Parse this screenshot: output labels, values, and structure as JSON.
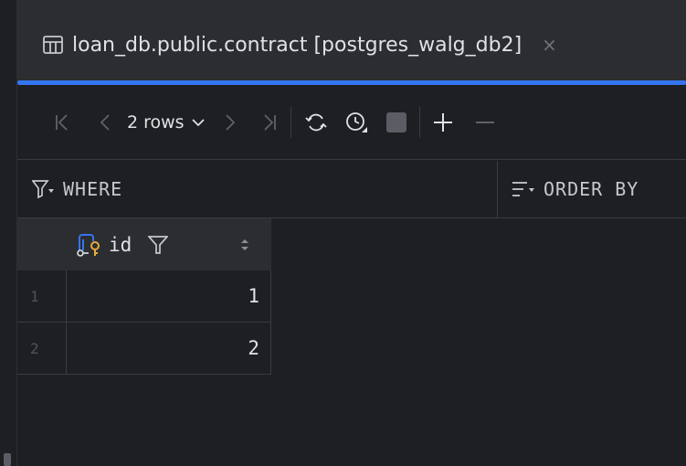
{
  "tab": {
    "title": "loan_db.public.contract [postgres_walg_db2]",
    "close_glyph": "×",
    "icon": "table-icon"
  },
  "toolbar": {
    "rows_label": "2 rows",
    "icons": [
      "first-page-icon",
      "prev-page-icon",
      "next-page-icon",
      "last-page-icon",
      "reload-icon",
      "history-icon",
      "stop-icon",
      "add-row-icon",
      "remove-row-icon"
    ]
  },
  "filter": {
    "where_label": "WHERE",
    "order_by_label": "ORDER BY"
  },
  "grid": {
    "columns": [
      {
        "name": "id",
        "icon": "primary-key-icon"
      }
    ],
    "rows": [
      {
        "num": "1",
        "id": "1"
      },
      {
        "num": "2",
        "id": "2"
      }
    ]
  },
  "colors": {
    "background": "#1e1f22",
    "panel": "#2b2d30",
    "accent": "#3574f0",
    "text": "#dfe1e5",
    "muted": "#6f737a"
  }
}
